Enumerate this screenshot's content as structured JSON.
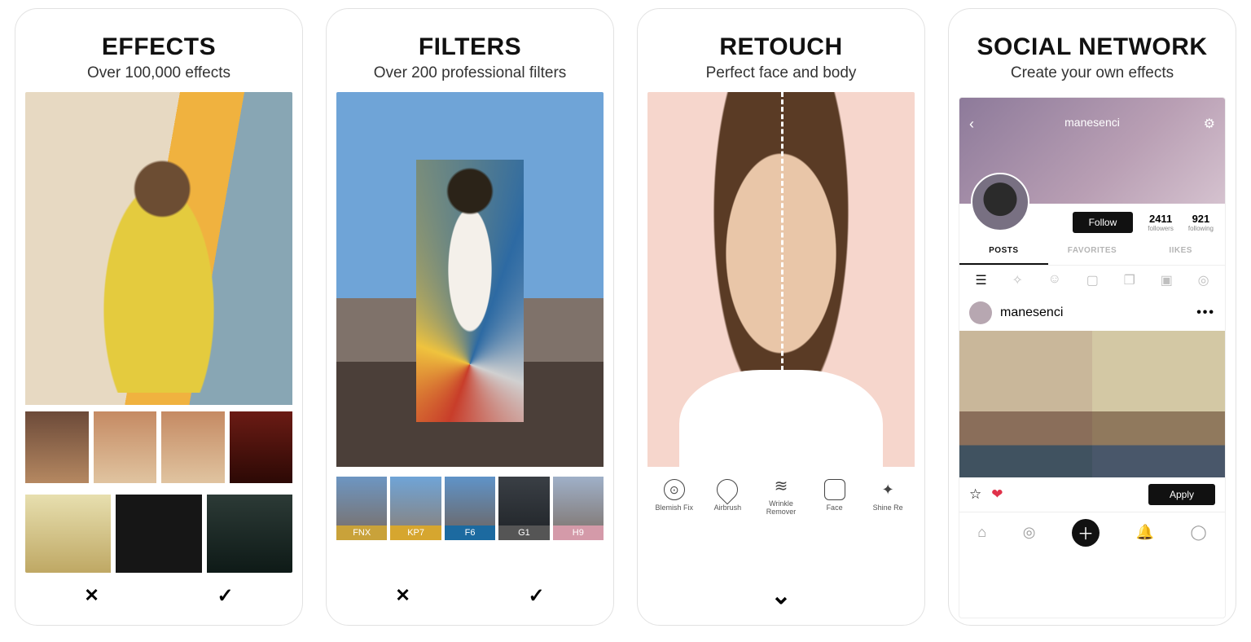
{
  "cards": {
    "effects": {
      "title": "EFFECTS",
      "subtitle": "Over 100,000 effects"
    },
    "filters": {
      "title": "FILTERS",
      "subtitle": "Over 200 professional filters",
      "strip": [
        "FNX",
        "KP7",
        "F6",
        "G1",
        "H9"
      ]
    },
    "retouch": {
      "title": "RETOUCH",
      "subtitle": "Perfect face and body",
      "tools": [
        "Blemish Fix",
        "Airbrush",
        "Wrinkle Remover",
        "Face",
        "Shine Re"
      ]
    },
    "social": {
      "title": "SOCIAL NETWORK",
      "subtitle": "Create your own effects"
    }
  },
  "social": {
    "username": "manesenci",
    "follow_label": "Follow",
    "stats": {
      "followers_n": "2411",
      "followers_l": "followers",
      "following_n": "921",
      "following_l": "following"
    },
    "tabs": [
      "POSTS",
      "FAVORITES",
      "IIKES"
    ],
    "post_user": "manesenci",
    "apply_label": "Apply"
  }
}
